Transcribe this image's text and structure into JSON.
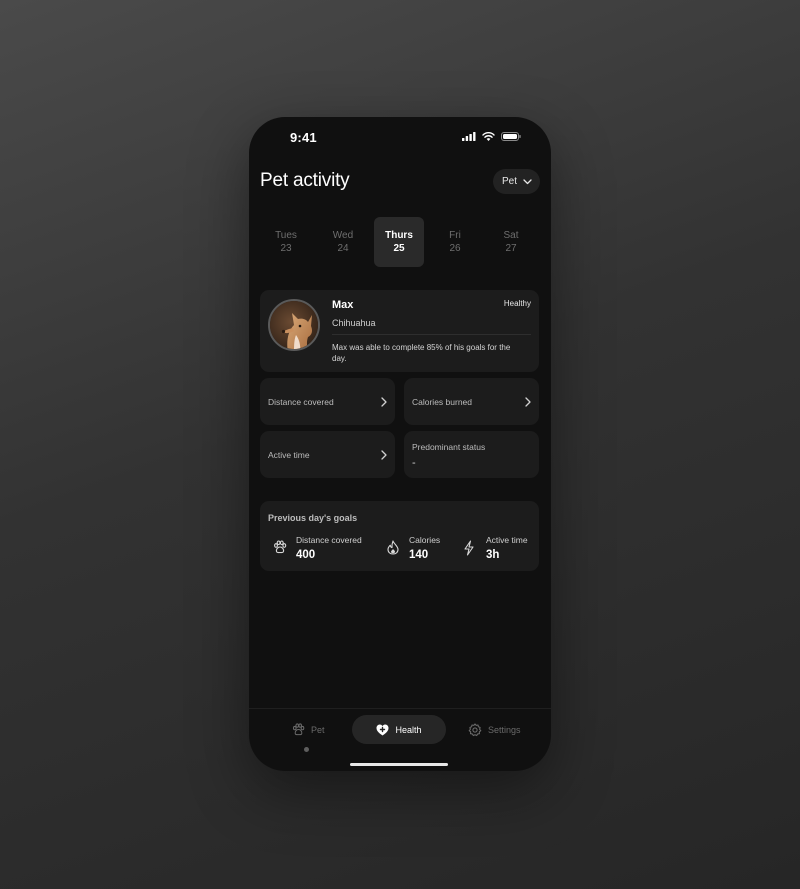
{
  "status_bar": {
    "time": "9:41"
  },
  "header": {
    "title": "Pet activity",
    "pet_selector": "Pet"
  },
  "days": [
    {
      "name": "Tues",
      "num": "23",
      "active": false
    },
    {
      "name": "Wed",
      "num": "24",
      "active": false
    },
    {
      "name": "Thurs",
      "num": "25",
      "active": true
    },
    {
      "name": "Fri",
      "num": "26",
      "active": false
    },
    {
      "name": "Sat",
      "num": "27",
      "active": false
    }
  ],
  "profile": {
    "name": "Max",
    "breed": "Chihuahua",
    "status": "Healthy",
    "summary": "Max was able to complete 85% of his goals for the day."
  },
  "metrics": {
    "distance": "Distance covered",
    "calories": "Calories burned",
    "active_time": "Active time",
    "predominant_status": {
      "label": "Predominant status",
      "value": "-"
    }
  },
  "goals": {
    "title": "Previous day's goals",
    "items": [
      {
        "label": "Distance covered",
        "value": "400",
        "icon": "paw-icon"
      },
      {
        "label": "Calories",
        "value": "140",
        "icon": "flame-icon"
      },
      {
        "label": "Active time",
        "value": "3h",
        "icon": "lightning-icon"
      }
    ]
  },
  "nav": {
    "pet": "Pet",
    "health": "Health",
    "settings": "Settings"
  },
  "colors": {
    "background": "#101010",
    "card": "#1c1c1c",
    "active_day": "#2a2a2a",
    "text_primary": "#ffffff",
    "text_muted": "#6e6e6e"
  }
}
